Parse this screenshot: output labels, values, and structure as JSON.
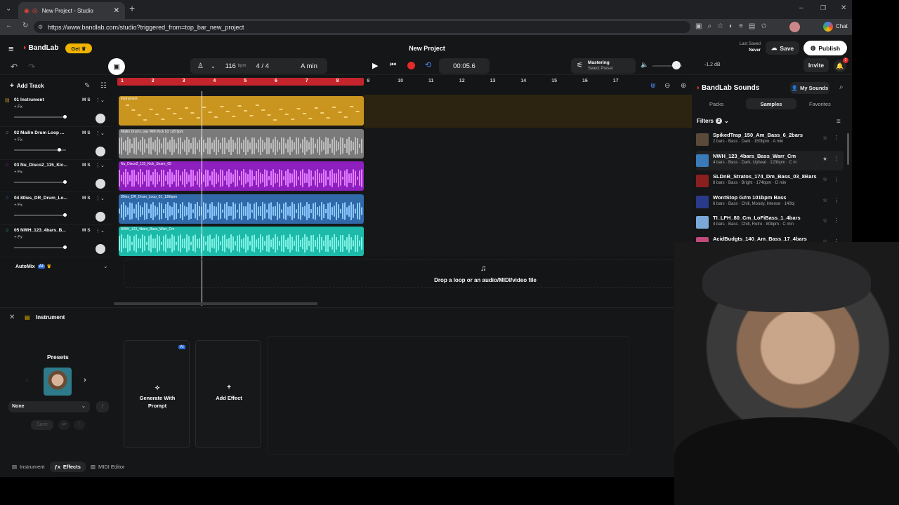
{
  "browser": {
    "tab_title": "New Project - Studio",
    "url": "https://www.bandlab.com/studio?triggered_from=top_bar_new_project",
    "chat_label": "Chat"
  },
  "header": {
    "logo": "BandLab",
    "get_label": "Get",
    "project_title": "New Project",
    "tempo": "116",
    "tempo_unit": "bpm",
    "time_sig": "4 / 4",
    "key": "A min",
    "time": "00:05.6",
    "mastering_title": "Mastering",
    "mastering_sub": "Select Preset",
    "volume_db": "-1.2 dB",
    "last_saved_label": "Last Saved",
    "last_saved_value": "Never",
    "save_label": "Save",
    "publish_label": "Publish",
    "invite_label": "Invite",
    "notif_count": "2"
  },
  "toolbar": {
    "add_track": "Add Track"
  },
  "ruler": {
    "marks": [
      "1",
      "2",
      "3",
      "4",
      "5",
      "6",
      "7",
      "8",
      "9",
      "10",
      "11",
      "12",
      "13",
      "14",
      "15",
      "16",
      "17"
    ]
  },
  "tracks": [
    {
      "num": "01",
      "name": "Instrument",
      "fx": "+ Fx",
      "region": "Instrument",
      "color": "#c9951f"
    },
    {
      "num": "02",
      "name": "Mailin Drum Loop ...",
      "fx": "+ Fx",
      "region": "Mailin Drum Loop With Kick 03 128 bpm",
      "color": "#7a7a7a"
    },
    {
      "num": "03",
      "name": "Nu_Disco2_115_Kic...",
      "fx": "+ Fx",
      "region": "Nu_Disco2_115_Kick_Snare_05",
      "color": "#8e1fbf"
    },
    {
      "num": "04",
      "name": "80ies_DR_Drum_Lo...",
      "fx": "+ Fx",
      "region": "80ies_DR_Drum_Loop_01_136bpm",
      "color": "#2f69a8"
    },
    {
      "num": "05",
      "name": "NWH_123_4bars_B...",
      "fx": "+ Fx",
      "region": "NWH_123_4bars_Bass_Warr_Cm",
      "color": "#1db9a9"
    }
  ],
  "mute_solo": "M   S",
  "automix": "AutoMix",
  "ai_badge": "AI",
  "drop_text": "Drop a loop or an audio/MIDI/video file",
  "sounds": {
    "title": "BandLab Sounds",
    "my_sounds": "My Sounds",
    "tabs": [
      "Packs",
      "Samples",
      "Favorites"
    ],
    "filters": "Filters",
    "filters_count": "2",
    "items": [
      {
        "title": "SpikedTrap_150_Am_Bass_6_2bars",
        "meta": "2 bars · Bass · Dark · 150bpm · A min"
      },
      {
        "title": "NWH_123_4bars_Bass_Warr_Cm",
        "meta": "4 bars · Bass · Dark, Upbeat · 123bpm · C m"
      },
      {
        "title": "SLDnB_Stratos_174_Dm_Bass_03_8Bars",
        "meta": "8 bars · Bass · Bright · 174bpm · D min"
      },
      {
        "title": "WontStop G#m 101bpm Bass",
        "meta": "6 bars · Bass · Chill, Moody, Intense · 140bj"
      },
      {
        "title": "TI_LFH_80_Cm_LoFiBass_1_4bars",
        "meta": "4 bars · Bass · Chill, Retro · 80bpm · C min"
      },
      {
        "title": "AcidBudgts_140_Am_Bass_17_4bars",
        "meta": ""
      }
    ]
  },
  "panel": {
    "title": "Instrument",
    "presets": "Presets",
    "preset_value": "None",
    "save": "Save",
    "gen_prompt": "Generate With Prompt",
    "add_effect": "Add Effect",
    "tabs": [
      "Instrument",
      "Effects",
      "MIDI Editor"
    ]
  }
}
